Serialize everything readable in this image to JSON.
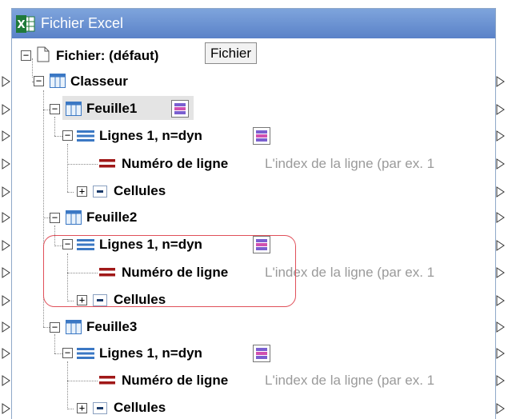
{
  "component": {
    "title": "Fichier Excel",
    "icon": "excel-file-icon"
  },
  "tree": {
    "file": {
      "label": "Fichier: (défaut)",
      "button_label": "Fichier"
    },
    "workbook": {
      "label": "Classeur"
    },
    "sheets": [
      {
        "label": "Feuille1",
        "rows": {
          "label": "Lignes 1, n=dyn"
        },
        "row_number": {
          "label": "Numéro de ligne",
          "description": "L'index de la ligne (par ex. 1"
        },
        "cells": {
          "label": "Cellules"
        }
      },
      {
        "label": "Feuille2",
        "rows": {
          "label": "Lignes 1, n=dyn"
        },
        "row_number": {
          "label": "Numéro de ligne",
          "description": "L'index de la ligne (par ex. 1"
        },
        "cells": {
          "label": "Cellules"
        }
      },
      {
        "label": "Feuille3",
        "rows": {
          "label": "Lignes 1, n=dyn"
        },
        "row_number": {
          "label": "Numéro de ligne",
          "description": "L'index de la ligne (par ex. 1"
        },
        "cells": {
          "label": "Cellules"
        }
      }
    ]
  },
  "colors": {
    "title_bar": "#5a82c8",
    "highlight": "#e0505a",
    "row_number_icon": "#a01818",
    "description_text": "#9a9a9a"
  }
}
